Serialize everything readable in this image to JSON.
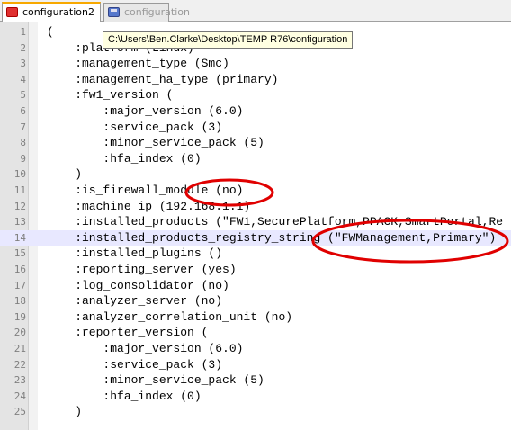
{
  "tabs": [
    {
      "label": "configuration2",
      "active": true
    },
    {
      "label": "configuration",
      "active": false
    }
  ],
  "tooltip": "C:\\Users\\Ben.Clarke\\Desktop\\TEMP R76\\configuration",
  "highlight_color": "#e8e8ff",
  "annotation_color": "#e00000",
  "lines": [
    {
      "num": "1",
      "text": "("
    },
    {
      "num": "2",
      "text": "    :platform (Linux)"
    },
    {
      "num": "3",
      "text": "    :management_type (Smc)"
    },
    {
      "num": "4",
      "text": "    :management_ha_type (primary)"
    },
    {
      "num": "5",
      "text": "    :fw1_version ("
    },
    {
      "num": "6",
      "text": "        :major_version (6.0)"
    },
    {
      "num": "7",
      "text": "        :service_pack (3)"
    },
    {
      "num": "8",
      "text": "        :minor_service_pack (5)"
    },
    {
      "num": "9",
      "text": "        :hfa_index (0)"
    },
    {
      "num": "10",
      "text": "    )"
    },
    {
      "num": "11",
      "text": "    :is_firewall_module (no)"
    },
    {
      "num": "12",
      "text": "    :machine_ip (192.168.1.1)"
    },
    {
      "num": "13",
      "text": "    :installed_products (\"FW1,SecurePlatform,PPACK,SmartPortal,Re"
    },
    {
      "num": "14",
      "text": "    :installed_products_registry_string (\"FWManagement,Primary\")"
    },
    {
      "num": "15",
      "text": "    :installed_plugins ()"
    },
    {
      "num": "16",
      "text": "    :reporting_server (yes)"
    },
    {
      "num": "17",
      "text": "    :log_consolidator (no)"
    },
    {
      "num": "18",
      "text": "    :analyzer_server (no)"
    },
    {
      "num": "19",
      "text": "    :analyzer_correlation_unit (no)"
    },
    {
      "num": "20",
      "text": "    :reporter_version ("
    },
    {
      "num": "21",
      "text": "        :major_version (6.0)"
    },
    {
      "num": "22",
      "text": "        :service_pack (3)"
    },
    {
      "num": "23",
      "text": "        :minor_service_pack (5)"
    },
    {
      "num": "24",
      "text": "        :hfa_index (0)"
    },
    {
      "num": "25",
      "text": "    )"
    }
  ]
}
